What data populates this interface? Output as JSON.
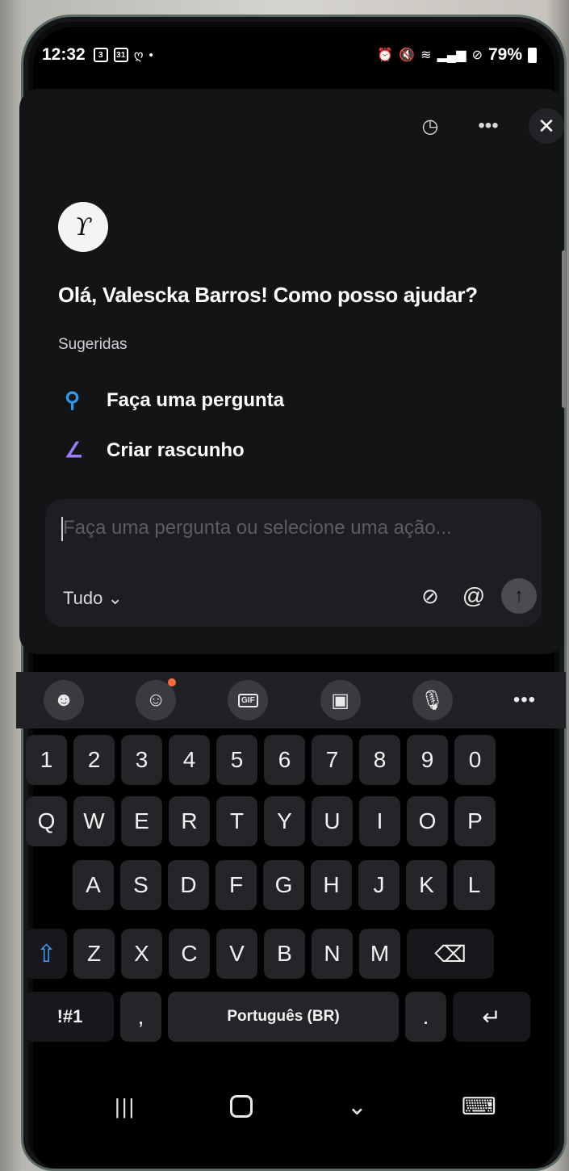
{
  "status_bar": {
    "time": "12:32",
    "left_icons": [
      "3",
      "31",
      "ღ",
      "•"
    ],
    "battery": "79%",
    "right_icons": [
      "alarm-icon",
      "mute-icon",
      "wifi-icon",
      "volte-icon",
      "signal-icon",
      "dnd-icon"
    ]
  },
  "panel": {
    "header_icons": [
      "history-icon",
      "more-icon",
      "close-icon"
    ],
    "history_glyph": "◷",
    "more_glyph": "•••",
    "close_glyph": "✕",
    "avatar_glyph": "ϒ",
    "greeting": "Olá, Valescka Barros! Como posso ajudar?",
    "suggested_label": "Sugeridas",
    "suggestions": [
      {
        "label": "Faça uma pergunta",
        "icon": "search-icon",
        "glyph": "⚲",
        "color": "#2d9cf0"
      },
      {
        "label": "Criar rascunho",
        "icon": "pen-icon",
        "glyph": "∠",
        "color": "#9b7bf7"
      }
    ],
    "composer": {
      "placeholder": "Faça uma pergunta ou selecione uma ação...",
      "mode": "Tudo",
      "mode_chevron": "⌄",
      "attach_glyph": "⊘",
      "mention_glyph": "@",
      "send_glyph": "↑"
    }
  },
  "keyboard": {
    "toolbar": [
      {
        "name": "sticker-icon",
        "glyph": "☻"
      },
      {
        "name": "emoji-icon",
        "glyph": "☺"
      },
      {
        "name": "gif-icon",
        "glyph": "GIF"
      },
      {
        "name": "clipboard-icon",
        "glyph": "▣"
      },
      {
        "name": "mic-icon",
        "glyph": "🎙"
      },
      {
        "name": "more-icon",
        "glyph": "•••"
      }
    ],
    "row1": [
      "1",
      "2",
      "3",
      "4",
      "5",
      "6",
      "7",
      "8",
      "9",
      "0"
    ],
    "row2": [
      "Q",
      "W",
      "E",
      "R",
      "T",
      "Y",
      "U",
      "I",
      "O",
      "P"
    ],
    "row3": [
      "A",
      "S",
      "D",
      "F",
      "G",
      "H",
      "J",
      "K",
      "L"
    ],
    "row4": [
      "Z",
      "X",
      "C",
      "V",
      "B",
      "N",
      "M"
    ],
    "shift_glyph": "⇧",
    "backspace_glyph": "⌫",
    "symbols": "!#1",
    "comma": ",",
    "space": "Português (BR)",
    "period": ".",
    "enter_glyph": "↵"
  },
  "navbar": {
    "recent_glyph": "|||",
    "back_glyph": "⌄",
    "keyboard_glyph": "⌨"
  }
}
